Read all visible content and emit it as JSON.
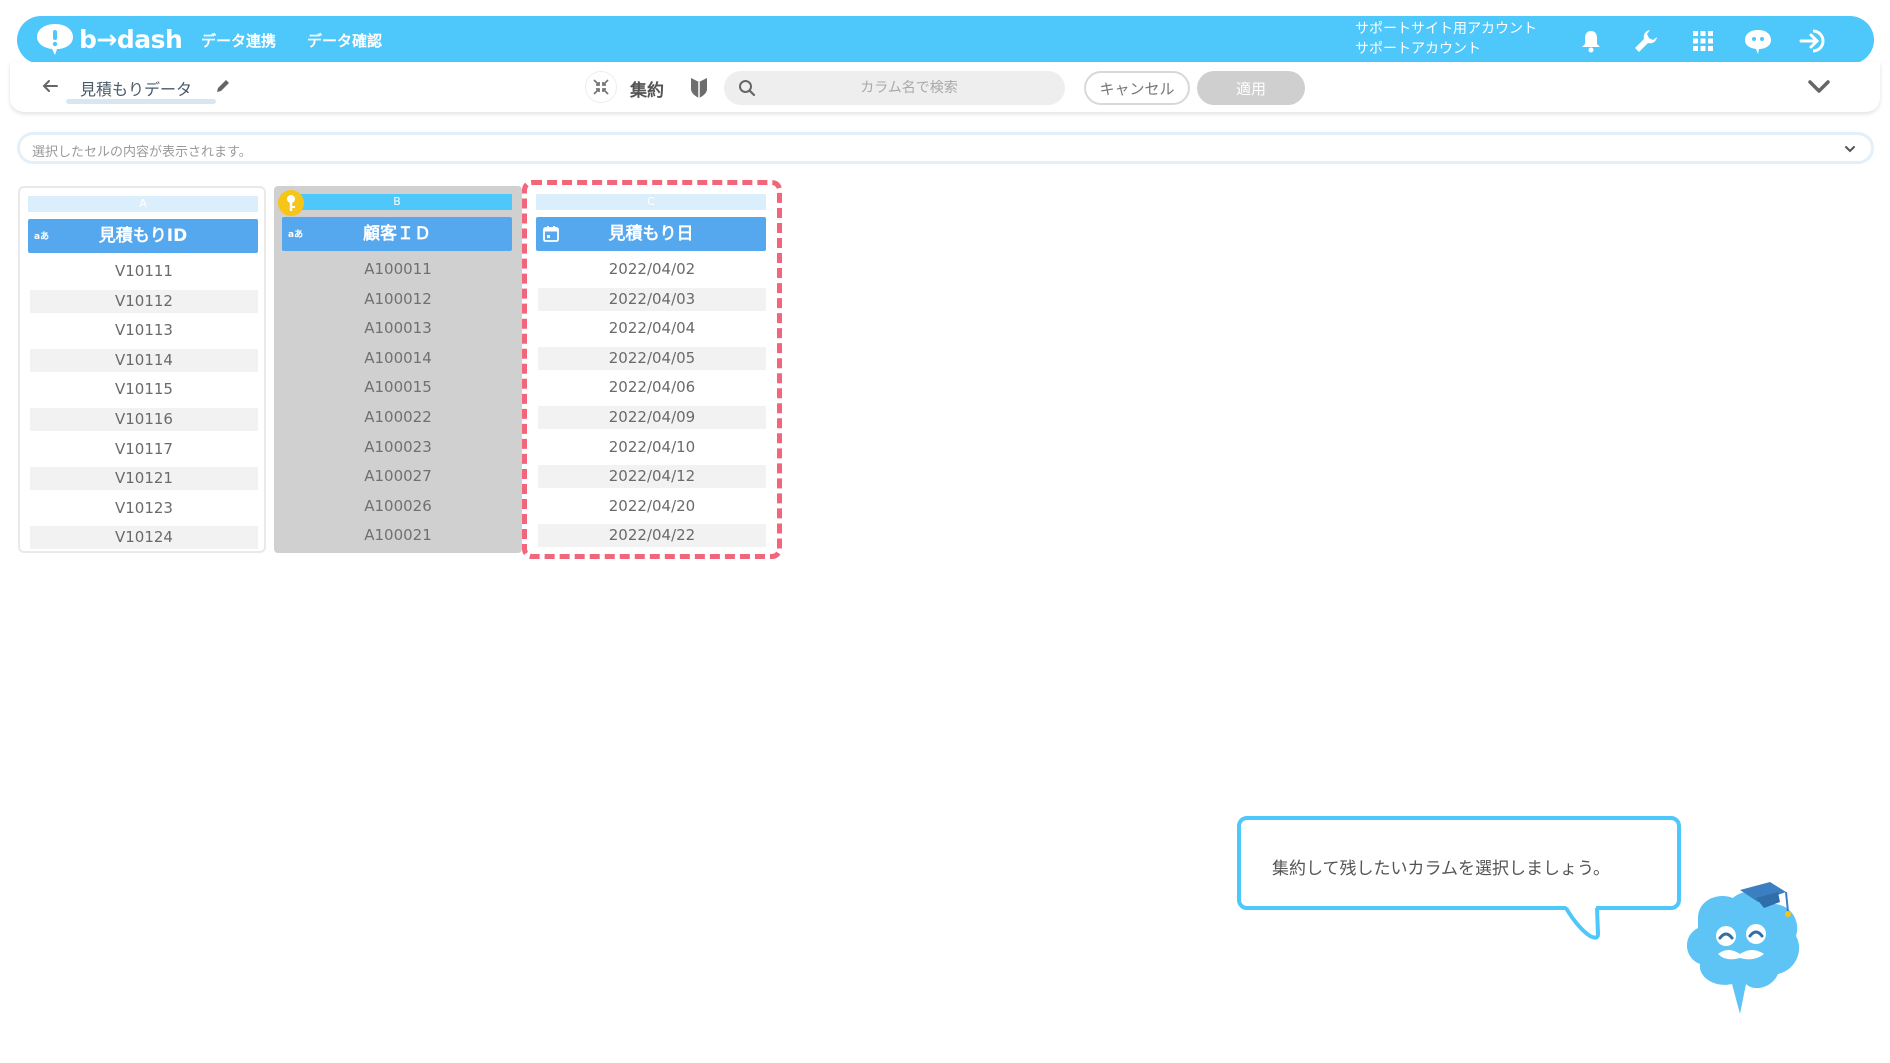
{
  "app": {
    "brand": "b→dash",
    "nav": [
      "データ連携",
      "データ確認"
    ],
    "account_line1": "サポートサイト用アカウント",
    "account_line2": "サポートアカウント"
  },
  "toolbar": {
    "title": "見積もりデータ",
    "aggregate_label": "集約",
    "search_placeholder": "カラム名で検索",
    "cancel_label": "キャンセル",
    "apply_label": "適用"
  },
  "cell_bar": {
    "text": "選択したセルの内容が表示されます。"
  },
  "columns": [
    {
      "letter": "A",
      "type_tag": "aあ",
      "header": "見積もりID",
      "values": [
        "V10111",
        "V10112",
        "V10113",
        "V10114",
        "V10115",
        "V10116",
        "V10117",
        "V10121",
        "V10123",
        "V10124"
      ]
    },
    {
      "letter": "B",
      "type_tag": "aあ",
      "header": "顧客ＩＤ",
      "values": [
        "A100011",
        "A100012",
        "A100013",
        "A100014",
        "A100015",
        "A100022",
        "A100023",
        "A100027",
        "A100026",
        "A100021"
      ]
    },
    {
      "letter": "C",
      "type_tag": "",
      "header": "見積もり日",
      "values": [
        "2022/04/02",
        "2022/04/03",
        "2022/04/04",
        "2022/04/05",
        "2022/04/06",
        "2022/04/09",
        "2022/04/10",
        "2022/04/12",
        "2022/04/20",
        "2022/04/22"
      ]
    }
  ],
  "guide": {
    "message": "集約して残したいカラムを選択しましょう。"
  },
  "colors": {
    "primary": "#4ec7fb",
    "header_blue": "#56a8ee",
    "highlight_dash": "#f2657a",
    "key_badge": "#f7c518",
    "selected_column_bg": "#d0d0d0"
  }
}
